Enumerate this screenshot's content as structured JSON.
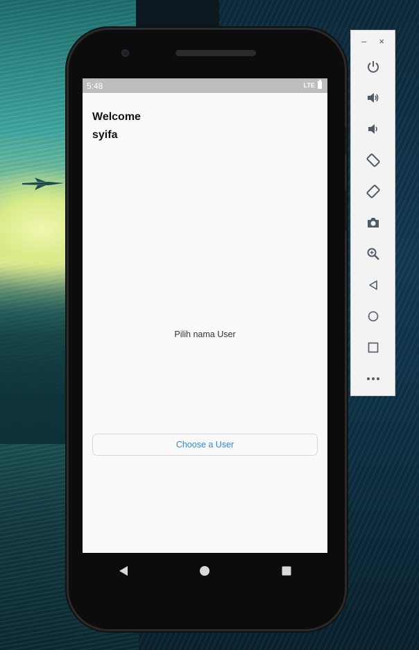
{
  "status_bar": {
    "time": "5:48",
    "network": "LTE"
  },
  "app": {
    "welcome_line1": "Welcome",
    "welcome_line2": "syifa",
    "prompt_text": "Pilih nama User",
    "choose_button_label": "Choose a User"
  },
  "navigation": {
    "back": "back-triangle-icon",
    "home": "home-circle-icon",
    "recents": "recents-square-icon"
  },
  "emulator_toolbar": {
    "window_controls": [
      "–",
      "×"
    ],
    "items": [
      "power-icon",
      "volume-up-icon",
      "volume-down-icon",
      "rotate-left-icon",
      "rotate-right-icon",
      "camera-icon",
      "zoom-icon",
      "back-icon",
      "home-icon",
      "overview-icon",
      "more-icon"
    ]
  },
  "colors": {
    "accent": "#2a8bd5",
    "status_bar": "#bdbdbd",
    "screen_bg": "#fafafa",
    "toolbar_icon": "#4f5b66"
  }
}
